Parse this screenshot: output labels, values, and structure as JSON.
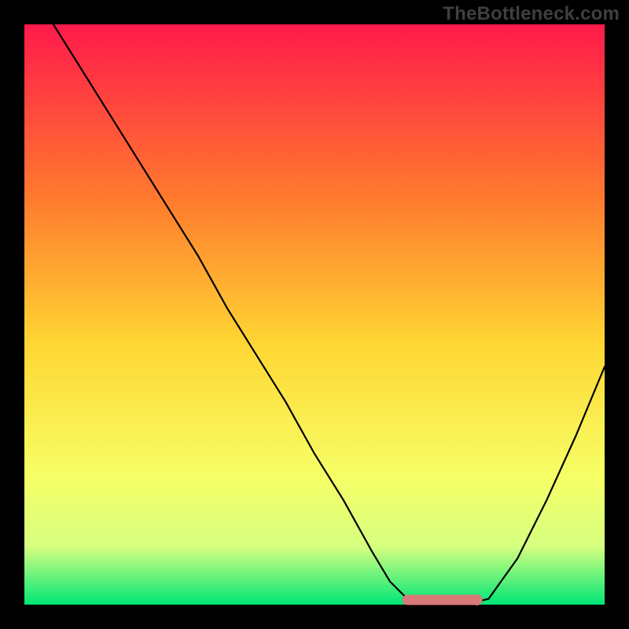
{
  "watermark": "TheBottleneck.com",
  "colors": {
    "page_bg": "#000000",
    "gradient_top": "#ff1a4b",
    "gradient_mid1": "#ff7a2e",
    "gradient_mid2": "#ffd633",
    "gradient_mid3": "#f6ff66",
    "gradient_low": "#d6ff80",
    "gradient_bottom": "#00e676",
    "curve": "#000000",
    "marker_fill": "#d87a78",
    "marker_stroke": "#d87a78"
  },
  "chart_data": {
    "type": "line",
    "title": "",
    "xlabel": "",
    "ylabel": "",
    "xlim": [
      0,
      100
    ],
    "ylim": [
      0,
      100
    ],
    "grid": false,
    "legend": false,
    "background": "vertical-gradient red-yellow-green",
    "series": [
      {
        "name": "bottleneck-curve",
        "color": "#000000",
        "x": [
          5,
          10,
          15,
          20,
          25,
          30,
          35,
          40,
          45,
          50,
          55,
          60,
          63,
          66,
          70,
          73,
          76,
          80,
          85,
          90,
          95,
          100
        ],
        "y": [
          100,
          92,
          84,
          76,
          68,
          60,
          51,
          43,
          35,
          26,
          18,
          9,
          4,
          1,
          0,
          0,
          0,
          1,
          8,
          18,
          29,
          41
        ]
      }
    ],
    "markers": [
      {
        "name": "optimal-range",
        "type": "segment",
        "color": "#d87a78",
        "x_from": 66,
        "x_to": 78,
        "y": 0
      },
      {
        "name": "current-config-point",
        "type": "point",
        "color": "#d87a78",
        "x": 78,
        "y": 0
      }
    ]
  }
}
